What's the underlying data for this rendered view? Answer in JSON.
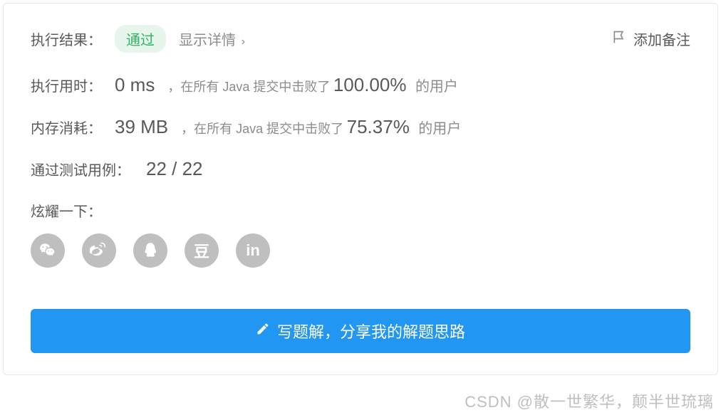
{
  "header": {
    "result_label": "执行结果：",
    "status": "通过",
    "show_details": "显示详情",
    "chevron": "›",
    "add_note": "添加备注"
  },
  "runtime": {
    "label": "执行用时：",
    "value": "0 ms",
    "desc": "，在所有 Java 提交中击败了",
    "percent": "100.00%",
    "suffix": "的用户"
  },
  "memory": {
    "label": "内存消耗：",
    "value": "39 MB",
    "desc": "，在所有 Java 提交中击败了",
    "percent": "75.37%",
    "suffix": "的用户"
  },
  "testcases": {
    "label": "通过测试用例：",
    "value": "22 / 22"
  },
  "share": {
    "label": "炫耀一下："
  },
  "action": {
    "write_solution": "写题解，分享我的解题思路"
  },
  "watermark": "CSDN @散一世繁华，颠半世琉璃"
}
